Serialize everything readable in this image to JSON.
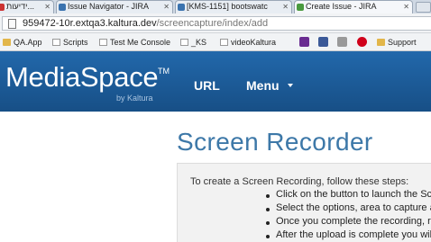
{
  "browser": {
    "tabs": [
      {
        "label": "ידיעות...",
        "active": false
      },
      {
        "label": "Issue Navigator - JIRA",
        "active": false
      },
      {
        "label": "[KMS-1151] bootswatc",
        "active": false
      },
      {
        "label": "Create Issue - JIRA",
        "active": true
      }
    ],
    "address": {
      "host": "959472-10r.extqa3.kaltura.dev",
      "path": "/screencapture/index/add"
    },
    "bookmarks": [
      {
        "label": "QA.App",
        "icon": "folder-icon"
      },
      {
        "label": "Scripts",
        "icon": "page-icon"
      },
      {
        "label": "Test Me Console",
        "icon": "page-icon"
      },
      {
        "label": "_KS",
        "icon": "page-icon"
      },
      {
        "label": "videoKaltura",
        "icon": "page-icon"
      },
      {
        "label": "Support",
        "icon": "folder-icon"
      }
    ]
  },
  "site": {
    "logo": "MediaSpace",
    "logo_tm": "TM",
    "logo_sub": "by Kaltura",
    "nav": {
      "url": "URL",
      "menu": "Menu"
    },
    "colors": {
      "header": "#1d5e9e",
      "title": "#3d78a8"
    }
  },
  "page": {
    "title": "Screen Recorder",
    "intro": "To create a Screen Recording, follow these steps:",
    "steps": [
      "Click on the button to launch the Screen Recorder",
      "Select the options, area to capture and",
      "Once you complete the recording, review",
      "After the upload is complete you will be"
    ]
  }
}
